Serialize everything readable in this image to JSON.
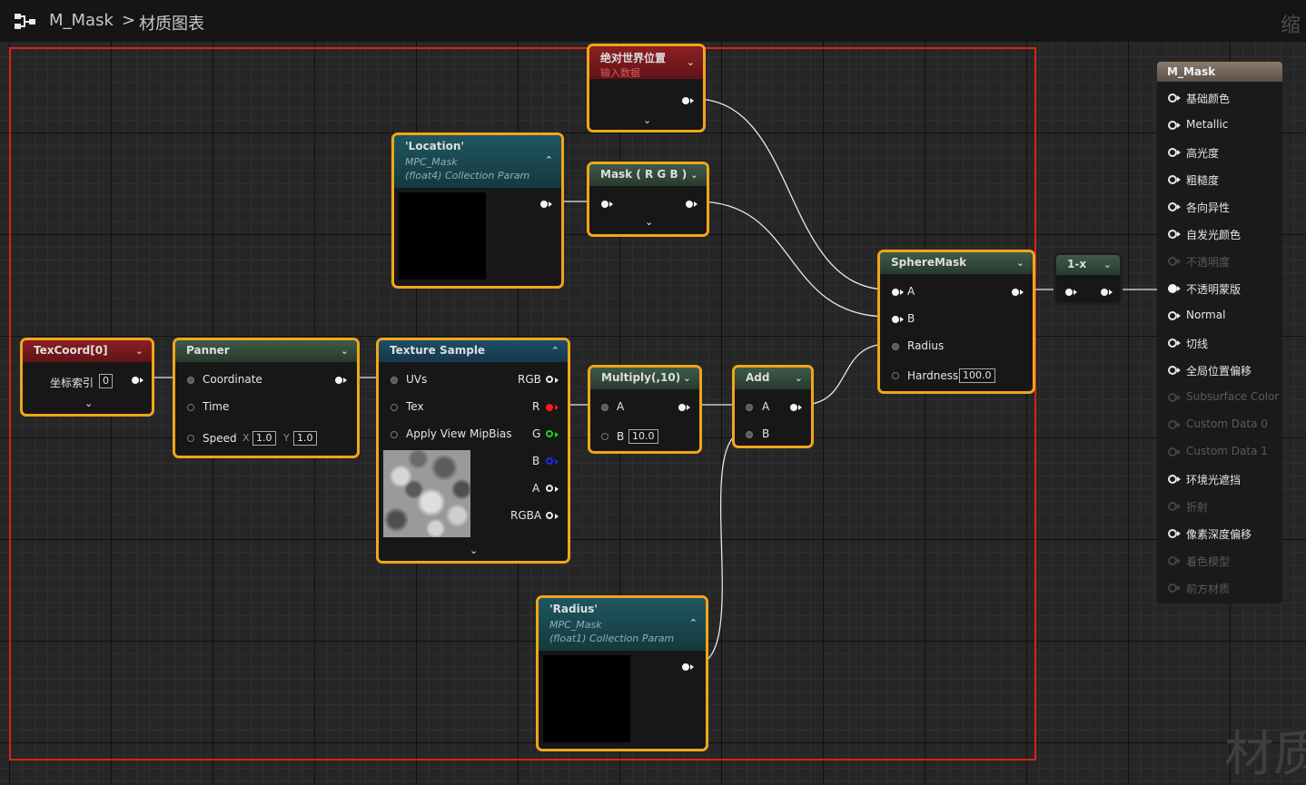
{
  "breadcrumb": {
    "asset": "M_Mask",
    "separator": ">",
    "graph": "材质图表"
  },
  "zoom_text": "缩",
  "watermark": "材质",
  "colors": {
    "selection_frame": "#d42514",
    "node_border": "#f0a61a",
    "wire": "#e8e8e8"
  },
  "nodes": {
    "world_pos": {
      "title": "绝对世界位置",
      "subtitle": "输入数据"
    },
    "location": {
      "title": "'Location'",
      "collection": "MPC_Mask",
      "kind": "(float4) Collection Param"
    },
    "mask_rgb": {
      "title": "Mask ( R G B )"
    },
    "sphere_mask": {
      "title": "SphereMask",
      "pin_a": "A",
      "pin_b": "B",
      "pin_radius": "Radius",
      "pin_hardness": "Hardness",
      "hardness_value": "100.0"
    },
    "one_minus": {
      "title": "1-x"
    },
    "texcoord": {
      "title": "TexCoord[0]",
      "index_label": "坐标索引",
      "index_value": "0"
    },
    "panner": {
      "title": "Panner",
      "coordinate": "Coordinate",
      "time": "Time",
      "speed": "Speed",
      "x_label": "X",
      "x_value": "1.0",
      "y_label": "Y",
      "y_value": "1.0"
    },
    "texture_sample": {
      "title": "Texture Sample",
      "uvs": "UVs",
      "tex": "Tex",
      "mipbias": "Apply View MipBias",
      "out_rgb": "RGB",
      "out_r": "R",
      "out_g": "G",
      "out_b": "B",
      "out_a": "A",
      "out_rgba": "RGBA"
    },
    "multiply": {
      "title": "Multiply(,10)",
      "pin_a": "A",
      "pin_b": "B",
      "b_value": "10.0"
    },
    "add": {
      "title": "Add",
      "pin_a": "A",
      "pin_b": "B"
    },
    "radius_param": {
      "title": "'Radius'",
      "collection": "MPC_Mask",
      "kind": "(float1) Collection Param"
    }
  },
  "output_node": {
    "title": "M_Mask",
    "pins": [
      {
        "label": "基础颜色",
        "enabled": true,
        "connected": false
      },
      {
        "label": "Metallic",
        "enabled": true,
        "connected": false
      },
      {
        "label": "高光度",
        "enabled": true,
        "connected": false
      },
      {
        "label": "粗糙度",
        "enabled": true,
        "connected": false
      },
      {
        "label": "各向异性",
        "enabled": true,
        "connected": false
      },
      {
        "label": "自发光颜色",
        "enabled": true,
        "connected": false
      },
      {
        "label": "不透明度",
        "enabled": false,
        "connected": false
      },
      {
        "label": "不透明蒙版",
        "enabled": true,
        "connected": true
      },
      {
        "label": "Normal",
        "enabled": true,
        "connected": false
      },
      {
        "label": "切线",
        "enabled": true,
        "connected": false
      },
      {
        "label": "全局位置偏移",
        "enabled": true,
        "connected": false
      },
      {
        "label": "Subsurface Color",
        "enabled": false,
        "connected": false
      },
      {
        "label": "Custom Data 0",
        "enabled": false,
        "connected": false
      },
      {
        "label": "Custom Data 1",
        "enabled": false,
        "connected": false
      },
      {
        "label": "环境光遮挡",
        "enabled": true,
        "connected": false
      },
      {
        "label": "折射",
        "enabled": false,
        "connected": false
      },
      {
        "label": "像素深度偏移",
        "enabled": true,
        "connected": false
      },
      {
        "label": "着色模型",
        "enabled": false,
        "connected": false
      },
      {
        "label": "前方材质",
        "enabled": false,
        "connected": false
      }
    ]
  }
}
